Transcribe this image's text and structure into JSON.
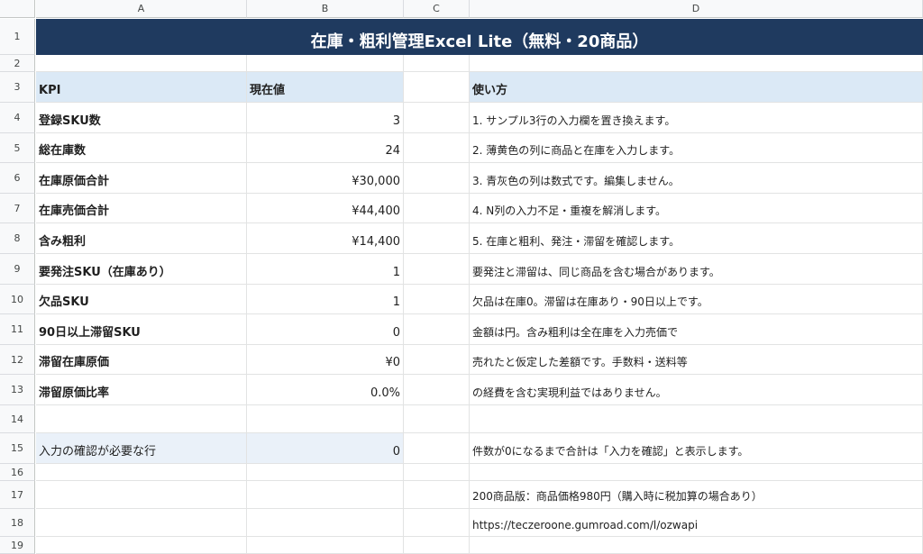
{
  "columns": [
    "A",
    "B",
    "C",
    "D"
  ],
  "rows": [
    "1",
    "2",
    "3",
    "4",
    "5",
    "6",
    "7",
    "8",
    "9",
    "10",
    "11",
    "12",
    "13",
    "14",
    "15",
    "16",
    "17",
    "18",
    "19"
  ],
  "title": "在庫・粗利管理Excel Lite（無料・20商品）",
  "kpi_header": {
    "label": "KPI",
    "value": "現在値"
  },
  "kpis": [
    {
      "label": "登録SKU数",
      "value": "3"
    },
    {
      "label": "総在庫数",
      "value": "24"
    },
    {
      "label": "在庫原価合計",
      "value": "¥30,000"
    },
    {
      "label": "在庫売価合計",
      "value": "¥44,400"
    },
    {
      "label": "含み粗利",
      "value": "¥14,400"
    },
    {
      "label": "要発注SKU（在庫あり）",
      "value": "1"
    },
    {
      "label": "欠品SKU",
      "value": "1"
    },
    {
      "label": "90日以上滞留SKU",
      "value": "0"
    },
    {
      "label": "滞留在庫原価",
      "value": "¥0"
    },
    {
      "label": "滞留原価比率",
      "value": "0.0%"
    }
  ],
  "confirm_row": {
    "label": "入力の確認が必要な行",
    "value": "0"
  },
  "usage_header": "使い方",
  "usage_lines": [
    "1. サンプル3行の入力欄を置き換えます。",
    "2. 薄黄色の列に商品と在庫を入力します。",
    "3. 青灰色の列は数式です。編集しません。",
    "4. N列の入力不足・重複を解消します。",
    "5. 在庫と粗利、発注・滞留を確認します。",
    "要発注と滞留は、同じ商品を含む場合があります。",
    "欠品は在庫0。滞留は在庫あり・90日以上です。",
    "金額は円。含み粗利は全在庫を入力売価で",
    "売れたと仮定した差額です。手数料・送料等",
    "の経費を含む実現利益ではありません。"
  ],
  "confirm_note": "件数が0になるまで合計は「入力を確認」と表示します。",
  "paid_version": "200商品版：商品価格980円（購入時に税加算の場合あり）",
  "link": "https://teczeroone.gumroad.com/l/ozwapi"
}
